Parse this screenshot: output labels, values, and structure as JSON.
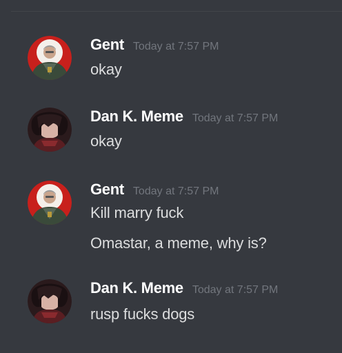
{
  "colors": {
    "background": "#36393f",
    "username": "#ffffff",
    "timestamp": "#72767d",
    "message": "#dcddde"
  },
  "messages": [
    {
      "author": "Gent",
      "avatar_icon": "gent-avatar-icon",
      "timestamp": "Today at 7:57 PM",
      "lines": [
        "okay"
      ]
    },
    {
      "author": "Dan K. Meme",
      "avatar_icon": "dan-avatar-icon",
      "timestamp": "Today at 7:57 PM",
      "lines": [
        "okay"
      ]
    },
    {
      "author": "Gent",
      "avatar_icon": "gent-avatar-icon",
      "timestamp": "Today at 7:57 PM",
      "lines": [
        "Kill marry fuck",
        "Omastar, a meme, why is?"
      ]
    },
    {
      "author": "Dan K. Meme",
      "avatar_icon": "dan-avatar-icon",
      "timestamp": "Today at 7:57 PM",
      "lines": [
        "rusp fucks dogs"
      ]
    }
  ]
}
